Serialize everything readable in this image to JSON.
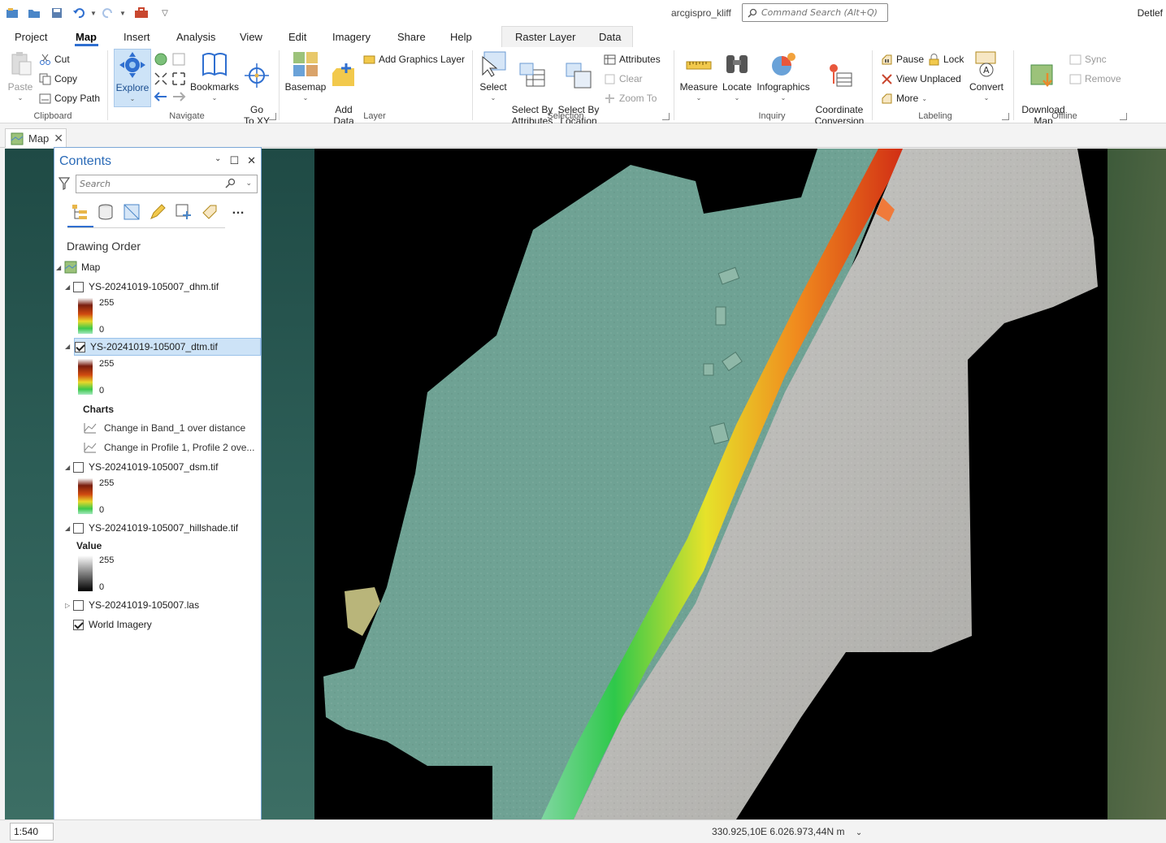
{
  "app": {
    "title": "arcgispro_kliff",
    "user": "Detlef"
  },
  "command_search": {
    "placeholder": "Command Search (Alt+Q)"
  },
  "tabs": [
    {
      "label": "Project"
    },
    {
      "label": "Map"
    },
    {
      "label": "Insert"
    },
    {
      "label": "Analysis"
    },
    {
      "label": "View"
    },
    {
      "label": "Edit"
    },
    {
      "label": "Imagery"
    },
    {
      "label": "Share"
    },
    {
      "label": "Help"
    },
    {
      "label": "Raster Layer"
    },
    {
      "label": "Data"
    }
  ],
  "ribbon": {
    "clipboard": {
      "label": "Clipboard",
      "paste": "Paste",
      "cut": "Cut",
      "copy": "Copy",
      "copy_path": "Copy Path"
    },
    "navigate": {
      "label": "Navigate",
      "explore": "Explore",
      "bookmarks": "Bookmarks",
      "go_to_xy": "Go\nTo XY"
    },
    "layer": {
      "label": "Layer",
      "basemap": "Basemap",
      "add_data": "Add\nData",
      "add_graphics": "Add Graphics Layer"
    },
    "selection": {
      "label": "Selection",
      "select": "Select",
      "select_by_attributes": "Select By\nAttributes",
      "select_by_location": "Select By\nLocation",
      "attributes": "Attributes",
      "clear": "Clear",
      "zoom_to": "Zoom To"
    },
    "inquiry": {
      "label": "Inquiry",
      "measure": "Measure",
      "locate": "Locate",
      "infographics": "Infographics",
      "coordinate_conversion": "Coordinate\nConversion"
    },
    "labeling": {
      "label": "Labeling",
      "pause": "Pause",
      "lock": "Lock",
      "view_unplaced": "View Unplaced",
      "more": "More",
      "convert": "Convert"
    },
    "offline": {
      "label": "Offline",
      "download_map": "Download\nMap",
      "sync": "Sync",
      "remove": "Remove"
    }
  },
  "view_tab": {
    "label": "Map"
  },
  "contents": {
    "title": "Contents",
    "search_placeholder": "Search",
    "drawing_order": "Drawing Order",
    "map_label": "Map",
    "layers": [
      {
        "name": "YS-20241019-105007_dhm.tif",
        "checked": false,
        "max": "255",
        "min": "0"
      },
      {
        "name": "YS-20241019-105007_dtm.tif",
        "checked": true,
        "max": "255",
        "min": "0",
        "selected": true
      },
      {
        "name": "YS-20241019-105007_dsm.tif",
        "checked": false,
        "max": "255",
        "min": "0"
      },
      {
        "name": "YS-20241019-105007_hillshade.tif",
        "checked": false,
        "value_label": "Value",
        "max": "255",
        "min": "0"
      },
      {
        "name": "YS-20241019-105007.las",
        "checked": false
      },
      {
        "name": "World Imagery",
        "checked": true
      }
    ],
    "charts_label": "Charts",
    "charts": [
      {
        "label": "Change in Band_1 over distance"
      },
      {
        "label": "Change in Profile 1, Profile 2 ove..."
      }
    ]
  },
  "status": {
    "scale": "1:540",
    "coordinates": "330.925,10E 6.026.973,44N m"
  },
  "colors": {
    "accent": "#2f6fd0",
    "title_blue": "#2a6ab7",
    "selection": "#cde3f7"
  }
}
